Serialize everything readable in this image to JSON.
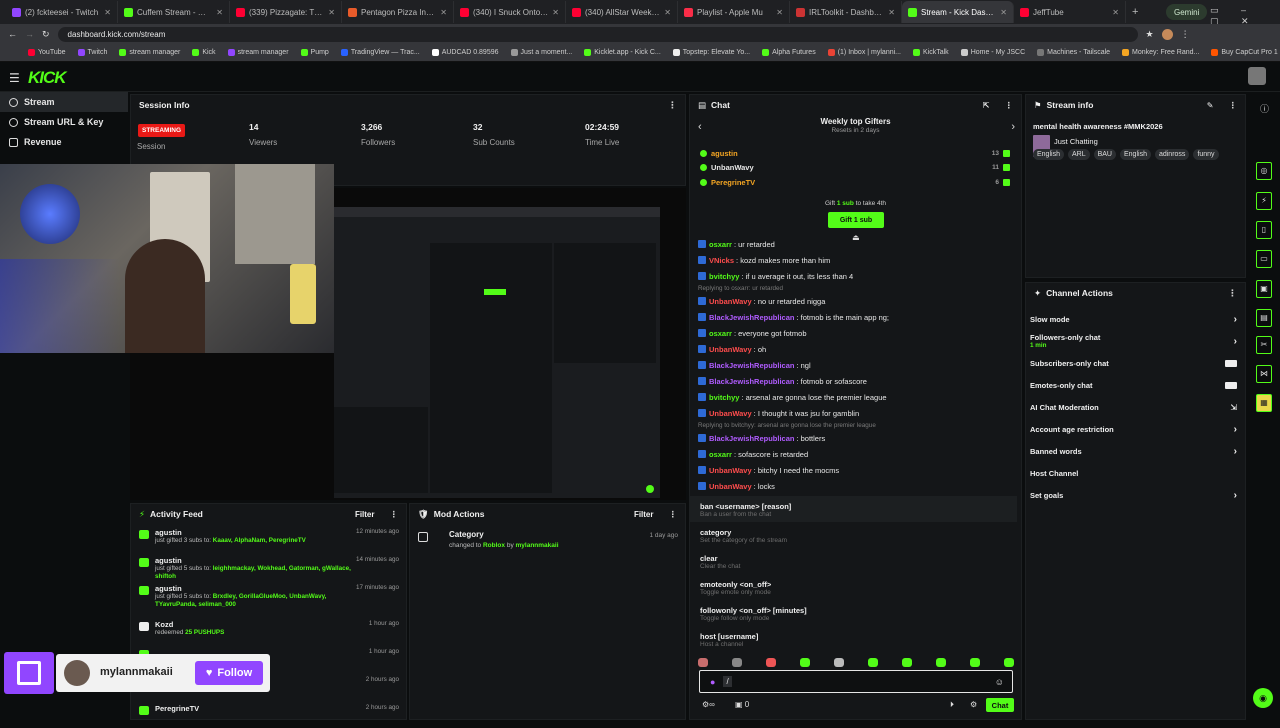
{
  "browser": {
    "tabs": [
      {
        "title": "(2) fckteesei - Twitch",
        "color": "#9146ff"
      },
      {
        "title": "Cuffem Stream - Watch Live",
        "color": "#53fc18"
      },
      {
        "title": "(339) Pizzagate: The Interne",
        "color": "#ff0033"
      },
      {
        "title": "Pentagon Pizza Index - Real",
        "color": "#e85b2a"
      },
      {
        "title": "(340) I Snuck Onto Jeffrey",
        "color": "#ff0033"
      },
      {
        "title": "(340) AllStar Weekend In Lo",
        "color": "#ff0033"
      },
      {
        "title": "Playlist - Apple Mu",
        "color": "#fa2d48"
      },
      {
        "title": "IRLToolkit - Dashboard",
        "color": "#cc3333"
      },
      {
        "title": "Stream - Kick Dashboard",
        "color": "#53fc18"
      },
      {
        "title": "JeffTube",
        "color": "#ff0033"
      }
    ],
    "gemini_label": "Gemini",
    "url": "dashboard.kick.com/stream",
    "bookmarks": [
      "YouTube",
      "Twitch",
      "stream manager",
      "Kick",
      "stream manager",
      "Pump",
      "TradingView — Trac...",
      "AUDCAD 0.89596",
      "Just a moment...",
      "Kicklet.app - Kick C...",
      "Topstep: Elevate Yo...",
      "Alpha Futures",
      "(1) Inbox | mylanni...",
      "KickTalk",
      "Home - My JSCC",
      "Machines - Tailscale",
      "Monkey: Free Rand...",
      "Buy CapCut Pro 1 M...",
      "IRLToolkit",
      "x.com/1langs=en"
    ]
  },
  "kick": {
    "logo": "KICK"
  },
  "nav": [
    {
      "label": "Stream"
    },
    {
      "label": "Stream URL & Key"
    },
    {
      "label": "Revenue"
    }
  ],
  "session": {
    "title": "Session Info",
    "live_badge": "STREAMING",
    "session_label": "Session",
    "stats": [
      {
        "value": "14",
        "label": "Viewers"
      },
      {
        "value": "3,266",
        "label": "Followers"
      },
      {
        "value": "32",
        "label": "Sub Counts"
      },
      {
        "value": "02:24:59",
        "label": "Time Live"
      }
    ]
  },
  "activity": {
    "title": "Activity Feed",
    "filter": "Filter",
    "items": [
      {
        "user": "agustin",
        "text": "just gifted 3 subs to:",
        "targets": "Kaaav, AlphaNam, PeregrineTV",
        "time": "12 minutes ago"
      },
      {
        "user": "agustin",
        "text": "just gifted 5 subs to:",
        "targets": "leighhmackay, Wokhead, Gatorman, gWallace, shiftoh",
        "time": "14 minutes ago"
      },
      {
        "user": "agustin",
        "text": "just gifted 5 subs to:",
        "targets": "Brxdley, GorillaGlueMoo, UnbanWavy, TYavruPanda, seliman_000",
        "time": "17 minutes ago"
      },
      {
        "user": "Kozd",
        "text": "redeemed",
        "targets": "25 PUSHUPS",
        "time": "1 hour ago"
      },
      {
        "user": "",
        "text": "",
        "targets": "",
        "time": "1 hour ago"
      },
      {
        "user": "",
        "text": "",
        "targets": "",
        "time": "2 hours ago"
      },
      {
        "user": "PeregrineTV",
        "text": "",
        "targets": "",
        "time": "2 hours ago"
      }
    ]
  },
  "mod_actions": {
    "title": "Mod Actions",
    "filter": "Filter",
    "item": {
      "title": "Category",
      "text": "changed to",
      "cat": "Roblox",
      "by": "by",
      "user": "mylannmakaii",
      "time": "1 day ago"
    }
  },
  "twitch_overlay": {
    "name": "mylannmakaii",
    "follow": "Follow"
  },
  "chat": {
    "title": "Chat",
    "gifters_title": "Weekly top Gifters",
    "gifters_sub": "Resets in 2 days",
    "gifters": [
      {
        "name": "agustin",
        "count": "13",
        "color": "#f5a623"
      },
      {
        "name": "UnbanWavy",
        "count": "11",
        "color": "#e8e8e8"
      },
      {
        "name": "PeregrineTV",
        "count": "6",
        "color": "#f5a623"
      }
    ],
    "gift_prompt_a": "Gift",
    "gift_prompt_b": "1 sub",
    "gift_prompt_c": "to take 4th",
    "gift_button": "Gift 1 sub",
    "messages": [
      {
        "user": "osxarr",
        "color": "#53fc18",
        "text": "ur retarded"
      },
      {
        "user": "VNicks",
        "color": "#ff4d4d",
        "text": "kozd makes more than him"
      },
      {
        "user": "bvitchyy",
        "color": "#53fc18",
        "text": "if u average it out, its less than 4"
      },
      {
        "reply": "Replying to osxarr: ur retarded"
      },
      {
        "user": "UnbanWavy",
        "color": "#ff4d4d",
        "text": "no ur retarded nigga"
      },
      {
        "user": "BlackJewishRepublican",
        "color": "#b05cff",
        "text": "fotmob is the main app ng;"
      },
      {
        "user": "osxarr",
        "color": "#53fc18",
        "text": "everyone got fotmob"
      },
      {
        "user": "UnbanWavy",
        "color": "#ff4d4d",
        "text": "oh"
      },
      {
        "user": "BlackJewishRepublican",
        "color": "#b05cff",
        "text": "ngl"
      },
      {
        "user": "BlackJewishRepublican",
        "color": "#b05cff",
        "text": "fotmob or sofascore"
      },
      {
        "user": "bvitchyy",
        "color": "#53fc18",
        "text": "arsenal are gonna lose the premier league"
      },
      {
        "user": "UnbanWavy",
        "color": "#ff4d4d",
        "text": "I thought it was jsu for gamblin"
      },
      {
        "reply": "Replying to bvitchyy: arsenal are gonna lose the premier league"
      },
      {
        "user": "BlackJewishRepublican",
        "color": "#b05cff",
        "text": "bottlers"
      },
      {
        "user": "osxarr",
        "color": "#53fc18",
        "text": "sofascore is retarded"
      },
      {
        "user": "UnbanWavy",
        "color": "#ff4d4d",
        "text": "bitchy I need the mocms"
      },
      {
        "user": "UnbanWavy",
        "color": "#ff4d4d",
        "text": "locks"
      }
    ],
    "commands": [
      {
        "cmd": "ban <username> [reason]",
        "desc": "Ban a user from the chat"
      },
      {
        "cmd": "category",
        "desc": "Set the category of the stream"
      },
      {
        "cmd": "clear",
        "desc": "Clear the chat"
      },
      {
        "cmd": "emoteonly <on_off>",
        "desc": "Toggle emote only mode"
      },
      {
        "cmd": "followonly <on_off> [minutes]",
        "desc": "Toggle follow only mode"
      },
      {
        "cmd": "host [username]",
        "desc": "Host a channel"
      }
    ],
    "input_value": "/",
    "viewer_count": "0",
    "send_label": "Chat"
  },
  "stream_info": {
    "title": "Stream info",
    "stream_title": "mental health awareness #MMK2026",
    "category": "Just Chatting",
    "tags": [
      "English",
      "ARL",
      "BAU",
      "English",
      "adinross",
      "funny"
    ]
  },
  "channel_actions": {
    "title": "Channel Actions",
    "items": [
      {
        "label": "Slow mode",
        "control": "arrow"
      },
      {
        "label": "Followers-only chat",
        "sub": "1 min",
        "control": "arrow"
      },
      {
        "label": "Subscribers-only chat",
        "control": "toggle"
      },
      {
        "label": "Emotes-only chat",
        "control": "toggle"
      },
      {
        "label": "AI Chat Moderation",
        "control": "external"
      },
      {
        "label": "Account age restriction",
        "control": "arrow"
      },
      {
        "label": "Banned words",
        "control": "arrow"
      },
      {
        "label": "Host Channel",
        "control": "none"
      },
      {
        "label": "Set goals",
        "control": "arrow"
      }
    ]
  },
  "colors": {
    "kick_green": "#53fc18",
    "live_red": "#e91916",
    "twitch_purple": "#9146ff"
  }
}
